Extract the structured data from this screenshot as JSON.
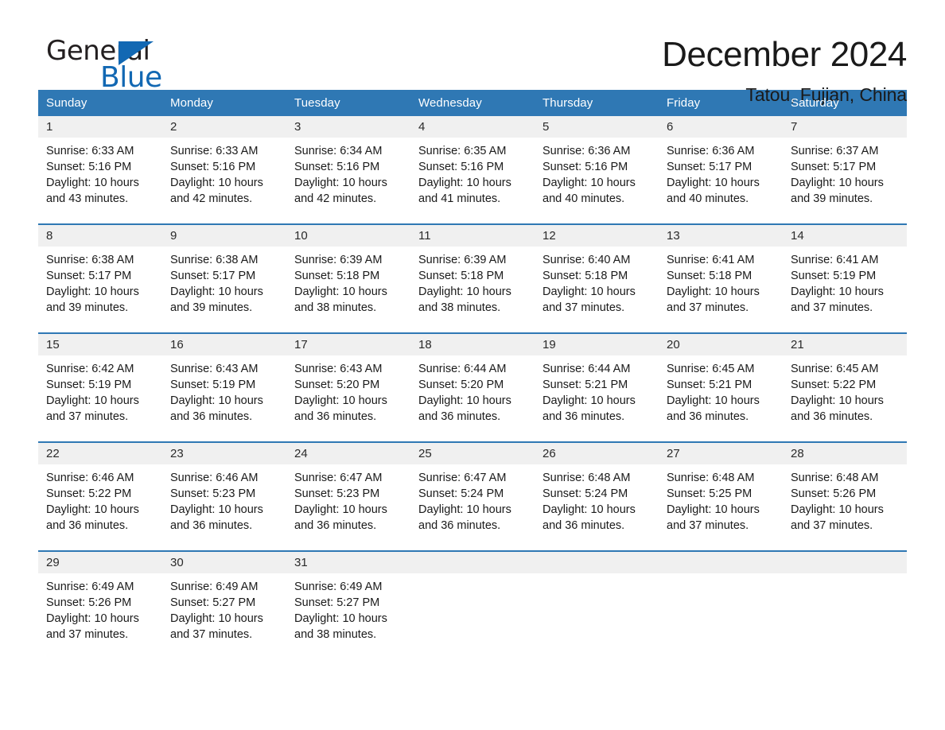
{
  "brand": {
    "name_top": "General",
    "name_bottom": "Blue",
    "triangle_icon": "blue-triangle-icon",
    "accent_color": "#1268b3"
  },
  "header": {
    "title": "December 2024",
    "location": "Tatou, Fujian, China"
  },
  "calendar": {
    "header_bg": "#2f78b4",
    "day_band_bg": "#f0f0f0",
    "weekdays": [
      "Sunday",
      "Monday",
      "Tuesday",
      "Wednesday",
      "Thursday",
      "Friday",
      "Saturday"
    ],
    "weeks": [
      [
        {
          "day": "1",
          "lines": [
            "Sunrise: 6:33 AM",
            "Sunset: 5:16 PM",
            "Daylight: 10 hours",
            "and 43 minutes."
          ]
        },
        {
          "day": "2",
          "lines": [
            "Sunrise: 6:33 AM",
            "Sunset: 5:16 PM",
            "Daylight: 10 hours",
            "and 42 minutes."
          ]
        },
        {
          "day": "3",
          "lines": [
            "Sunrise: 6:34 AM",
            "Sunset: 5:16 PM",
            "Daylight: 10 hours",
            "and 42 minutes."
          ]
        },
        {
          "day": "4",
          "lines": [
            "Sunrise: 6:35 AM",
            "Sunset: 5:16 PM",
            "Daylight: 10 hours",
            "and 41 minutes."
          ]
        },
        {
          "day": "5",
          "lines": [
            "Sunrise: 6:36 AM",
            "Sunset: 5:16 PM",
            "Daylight: 10 hours",
            "and 40 minutes."
          ]
        },
        {
          "day": "6",
          "lines": [
            "Sunrise: 6:36 AM",
            "Sunset: 5:17 PM",
            "Daylight: 10 hours",
            "and 40 minutes."
          ]
        },
        {
          "day": "7",
          "lines": [
            "Sunrise: 6:37 AM",
            "Sunset: 5:17 PM",
            "Daylight: 10 hours",
            "and 39 minutes."
          ]
        }
      ],
      [
        {
          "day": "8",
          "lines": [
            "Sunrise: 6:38 AM",
            "Sunset: 5:17 PM",
            "Daylight: 10 hours",
            "and 39 minutes."
          ]
        },
        {
          "day": "9",
          "lines": [
            "Sunrise: 6:38 AM",
            "Sunset: 5:17 PM",
            "Daylight: 10 hours",
            "and 39 minutes."
          ]
        },
        {
          "day": "10",
          "lines": [
            "Sunrise: 6:39 AM",
            "Sunset: 5:18 PM",
            "Daylight: 10 hours",
            "and 38 minutes."
          ]
        },
        {
          "day": "11",
          "lines": [
            "Sunrise: 6:39 AM",
            "Sunset: 5:18 PM",
            "Daylight: 10 hours",
            "and 38 minutes."
          ]
        },
        {
          "day": "12",
          "lines": [
            "Sunrise: 6:40 AM",
            "Sunset: 5:18 PM",
            "Daylight: 10 hours",
            "and 37 minutes."
          ]
        },
        {
          "day": "13",
          "lines": [
            "Sunrise: 6:41 AM",
            "Sunset: 5:18 PM",
            "Daylight: 10 hours",
            "and 37 minutes."
          ]
        },
        {
          "day": "14",
          "lines": [
            "Sunrise: 6:41 AM",
            "Sunset: 5:19 PM",
            "Daylight: 10 hours",
            "and 37 minutes."
          ]
        }
      ],
      [
        {
          "day": "15",
          "lines": [
            "Sunrise: 6:42 AM",
            "Sunset: 5:19 PM",
            "Daylight: 10 hours",
            "and 37 minutes."
          ]
        },
        {
          "day": "16",
          "lines": [
            "Sunrise: 6:43 AM",
            "Sunset: 5:19 PM",
            "Daylight: 10 hours",
            "and 36 minutes."
          ]
        },
        {
          "day": "17",
          "lines": [
            "Sunrise: 6:43 AM",
            "Sunset: 5:20 PM",
            "Daylight: 10 hours",
            "and 36 minutes."
          ]
        },
        {
          "day": "18",
          "lines": [
            "Sunrise: 6:44 AM",
            "Sunset: 5:20 PM",
            "Daylight: 10 hours",
            "and 36 minutes."
          ]
        },
        {
          "day": "19",
          "lines": [
            "Sunrise: 6:44 AM",
            "Sunset: 5:21 PM",
            "Daylight: 10 hours",
            "and 36 minutes."
          ]
        },
        {
          "day": "20",
          "lines": [
            "Sunrise: 6:45 AM",
            "Sunset: 5:21 PM",
            "Daylight: 10 hours",
            "and 36 minutes."
          ]
        },
        {
          "day": "21",
          "lines": [
            "Sunrise: 6:45 AM",
            "Sunset: 5:22 PM",
            "Daylight: 10 hours",
            "and 36 minutes."
          ]
        }
      ],
      [
        {
          "day": "22",
          "lines": [
            "Sunrise: 6:46 AM",
            "Sunset: 5:22 PM",
            "Daylight: 10 hours",
            "and 36 minutes."
          ]
        },
        {
          "day": "23",
          "lines": [
            "Sunrise: 6:46 AM",
            "Sunset: 5:23 PM",
            "Daylight: 10 hours",
            "and 36 minutes."
          ]
        },
        {
          "day": "24",
          "lines": [
            "Sunrise: 6:47 AM",
            "Sunset: 5:23 PM",
            "Daylight: 10 hours",
            "and 36 minutes."
          ]
        },
        {
          "day": "25",
          "lines": [
            "Sunrise: 6:47 AM",
            "Sunset: 5:24 PM",
            "Daylight: 10 hours",
            "and 36 minutes."
          ]
        },
        {
          "day": "26",
          "lines": [
            "Sunrise: 6:48 AM",
            "Sunset: 5:24 PM",
            "Daylight: 10 hours",
            "and 36 minutes."
          ]
        },
        {
          "day": "27",
          "lines": [
            "Sunrise: 6:48 AM",
            "Sunset: 5:25 PM",
            "Daylight: 10 hours",
            "and 37 minutes."
          ]
        },
        {
          "day": "28",
          "lines": [
            "Sunrise: 6:48 AM",
            "Sunset: 5:26 PM",
            "Daylight: 10 hours",
            "and 37 minutes."
          ]
        }
      ],
      [
        {
          "day": "29",
          "lines": [
            "Sunrise: 6:49 AM",
            "Sunset: 5:26 PM",
            "Daylight: 10 hours",
            "and 37 minutes."
          ]
        },
        {
          "day": "30",
          "lines": [
            "Sunrise: 6:49 AM",
            "Sunset: 5:27 PM",
            "Daylight: 10 hours",
            "and 37 minutes."
          ]
        },
        {
          "day": "31",
          "lines": [
            "Sunrise: 6:49 AM",
            "Sunset: 5:27 PM",
            "Daylight: 10 hours",
            "and 38 minutes."
          ]
        },
        {
          "day": "",
          "lines": []
        },
        {
          "day": "",
          "lines": []
        },
        {
          "day": "",
          "lines": []
        },
        {
          "day": "",
          "lines": []
        }
      ]
    ]
  }
}
